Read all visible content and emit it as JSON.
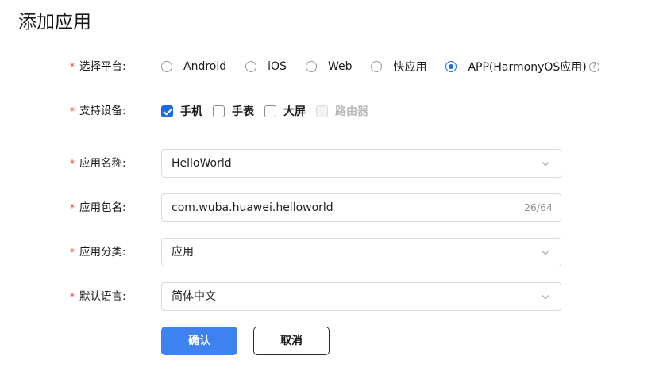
{
  "page": {
    "title": "添加应用"
  },
  "form": {
    "platform": {
      "label": "选择平台:",
      "required": "*",
      "options": [
        {
          "label": "Android",
          "selected": false
        },
        {
          "label": "iOS",
          "selected": false
        },
        {
          "label": "Web",
          "selected": false
        },
        {
          "label": "快应用",
          "selected": false
        },
        {
          "label": "APP(HarmonyOS应用)",
          "selected": true
        }
      ],
      "help_icon": "?"
    },
    "devices": {
      "label": "支持设备:",
      "required": "*",
      "options": [
        {
          "label": "手机",
          "checked": true,
          "disabled": false
        },
        {
          "label": "手表",
          "checked": false,
          "disabled": false
        },
        {
          "label": "大屏",
          "checked": false,
          "disabled": false
        },
        {
          "label": "路由器",
          "checked": false,
          "disabled": true
        }
      ]
    },
    "app_name": {
      "label": "应用名称:",
      "required": "*",
      "value": "HelloWorld"
    },
    "package_name": {
      "label": "应用包名:",
      "required": "*",
      "value": "com.wuba.huawei.helloworld",
      "counter": "26/64"
    },
    "category": {
      "label": "应用分类:",
      "required": "*",
      "value": "应用"
    },
    "language": {
      "label": "默认语言:",
      "required": "*",
      "value": "简体中文"
    }
  },
  "buttons": {
    "confirm": "确认",
    "cancel": "取消"
  },
  "colors": {
    "accent": "#1c6be4",
    "primary_button": "#3d82f0",
    "required_mark": "#e84026"
  }
}
